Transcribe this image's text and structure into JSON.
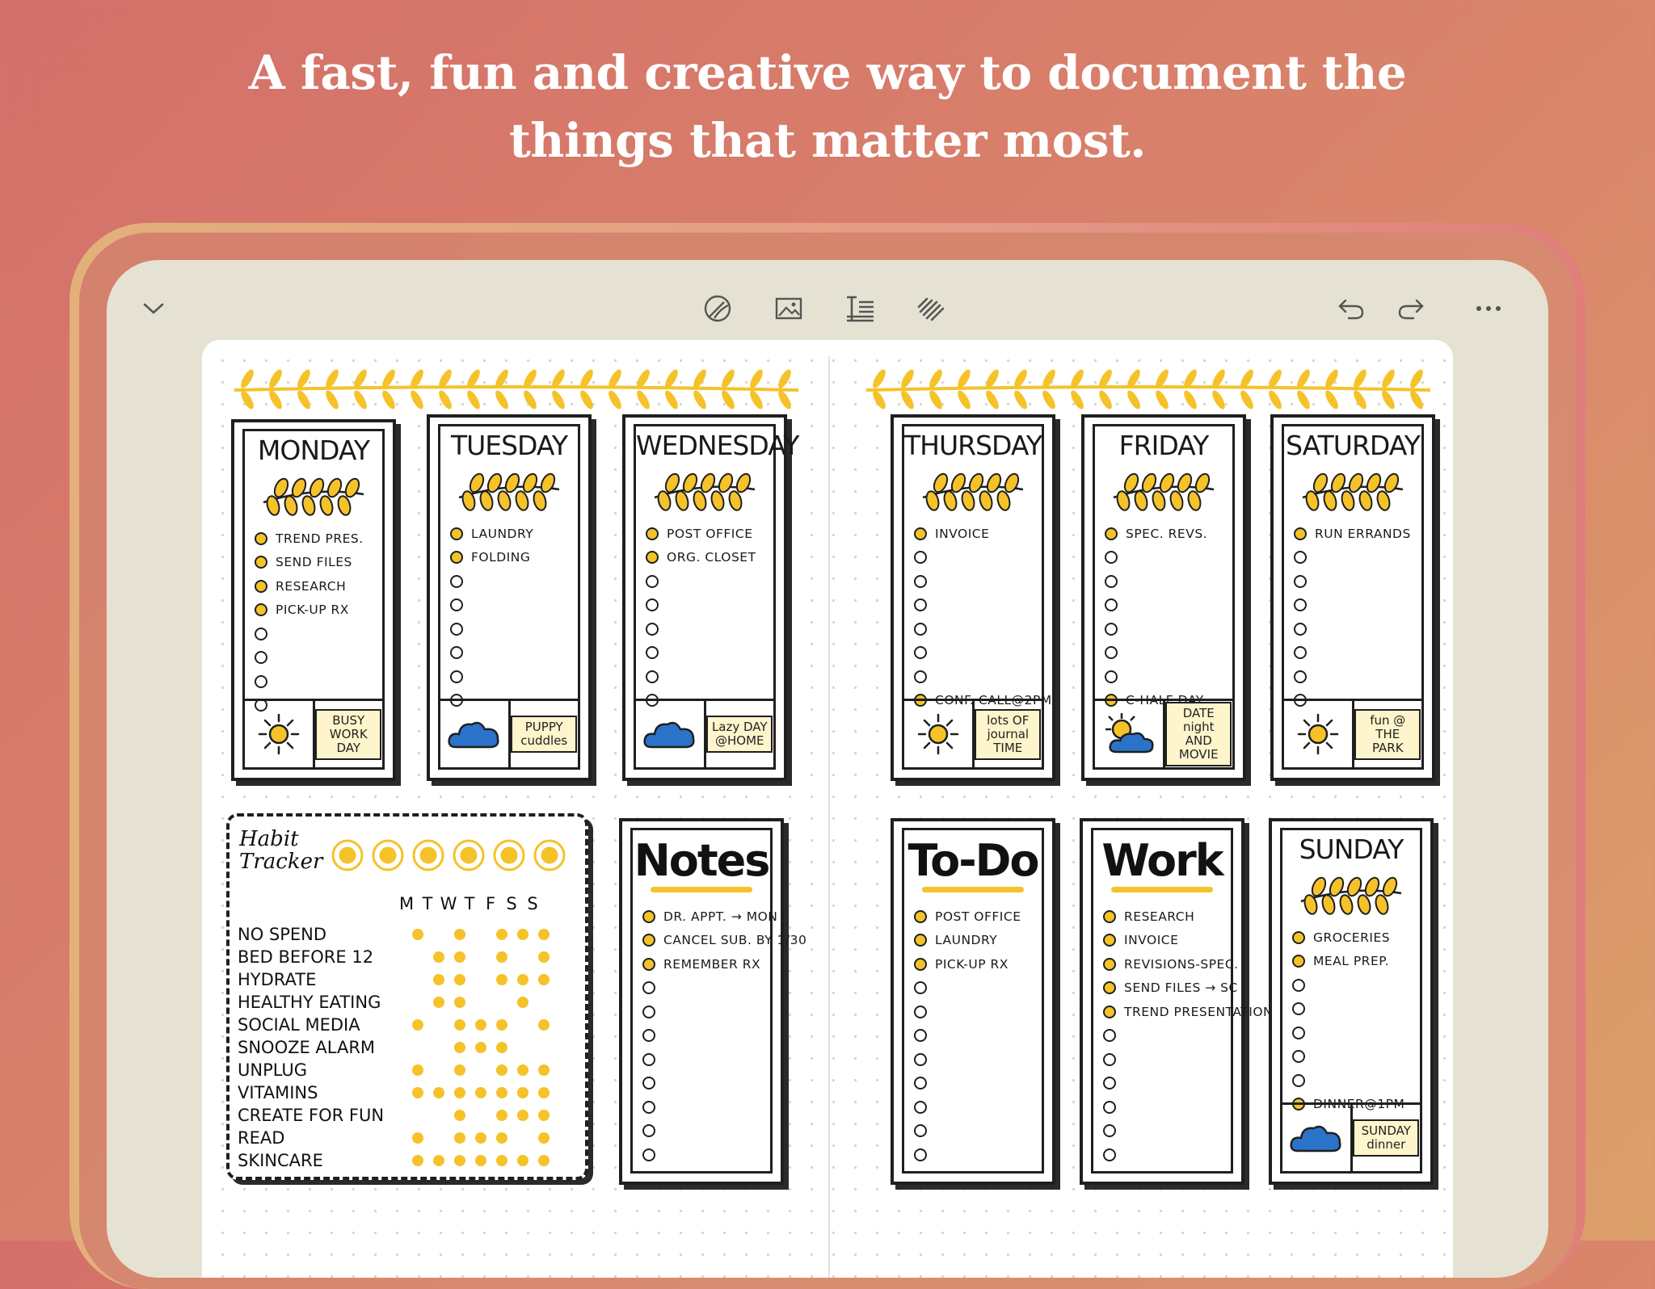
{
  "headline": {
    "line1": "A fast, fun and creative way to document the",
    "line2": "things that matter most."
  },
  "toolbar": {
    "collapse_icon": "chevron-down-icon",
    "tools": [
      "pen-eraser-icon",
      "image-icon",
      "text-icon",
      "scribble-icon"
    ],
    "undo_icon": "undo-icon",
    "redo_icon": "redo-icon",
    "more_icon": "more-icon"
  },
  "colors": {
    "accent": "#f5c22a",
    "ink": "#1f1f1f",
    "cloud": "#2a73c8"
  },
  "days": [
    {
      "title": "MONDAY",
      "tasks": [
        "TREND PRES.",
        "SEND FILES",
        "RESEARCH",
        "PICK-UP RX",
        "",
        "",
        "",
        ""
      ],
      "filled": 4,
      "doodle": "BUSY WORK DAY",
      "weather": "sun-icon"
    },
    {
      "title": "TUESDAY",
      "tasks": [
        "LAUNDRY",
        "FOLDING",
        "",
        "",
        "",
        "",
        "",
        ""
      ],
      "filled": 2,
      "doodle": "PUPPY cuddles",
      "weather": "cloud-icon"
    },
    {
      "title": "WEDNESDAY",
      "tasks": [
        "POST OFFICE",
        "ORG. CLOSET",
        "",
        "",
        "",
        "",
        "",
        ""
      ],
      "filled": 2,
      "doodle": "Lazy DAY @HOME",
      "weather": "cloud-icon"
    },
    {
      "title": "THURSDAY",
      "tasks": [
        "INVOICE",
        "",
        "",
        "",
        "",
        "",
        "",
        "CONF. CALL@2PM"
      ],
      "filled": [
        0,
        7
      ],
      "doodle": "lots OF journal TIME",
      "weather": "sun-icon"
    },
    {
      "title": "FRIDAY",
      "tasks": [
        "SPEC. REVS.",
        "",
        "",
        "",
        "",
        "",
        "",
        "C-HALF DAY"
      ],
      "filled": [
        0,
        7
      ],
      "doodle": "DATE night AND MOVIE",
      "weather": "sun-cloud-icon"
    },
    {
      "title": "SATURDAY",
      "tasks": [
        "RUN ERRANDS",
        "",
        "",
        "",
        "",
        "",
        "",
        ""
      ],
      "filled": [
        0
      ],
      "doodle": "fun @ THE PARK",
      "weather": "sun-icon"
    }
  ],
  "notes": {
    "title": "Notes",
    "tasks": [
      "DR. APPT. → MON",
      "CANCEL SUB. BY 1/30",
      "REMEMBER RX",
      "",
      "",
      "",
      "",
      "",
      "",
      "",
      ""
    ],
    "filled": 3
  },
  "todo": {
    "title": "To-Do",
    "tasks": [
      "POST OFFICE",
      "LAUNDRY",
      "PICK-UP RX",
      "",
      "",
      "",
      "",
      "",
      "",
      "",
      ""
    ],
    "filled": 3
  },
  "work": {
    "title": "Work",
    "tasks": [
      "RESEARCH",
      "INVOICE",
      "REVISIONS-SPEC.",
      "SEND FILES → SC",
      "TREND PRESENTATION",
      "",
      "",
      "",
      "",
      "",
      ""
    ],
    "filled": 5
  },
  "sunday": {
    "title": "SUNDAY",
    "tasks": [
      "GROCERIES",
      "MEAL PREP.",
      "",
      "",
      "",
      "",
      "",
      "DINNER@1PM"
    ],
    "filled": [
      0,
      1,
      7
    ],
    "doodle": "SUNDAY dinner",
    "weather": "cloud-icon"
  },
  "habit_tracker": {
    "title": "Habit Tracker",
    "days": [
      "M",
      "T",
      "W",
      "T",
      "F",
      "S",
      "S"
    ],
    "habits": [
      {
        "label": "NO SPEND",
        "marks": [
          1,
          0,
          1,
          0,
          1,
          1,
          1
        ]
      },
      {
        "label": "BED BEFORE 12",
        "marks": [
          0,
          1,
          1,
          0,
          1,
          0,
          1
        ]
      },
      {
        "label": "HYDRATE",
        "marks": [
          0,
          1,
          1,
          0,
          1,
          1,
          1
        ]
      },
      {
        "label": "HEALTHY EATING",
        "marks": [
          0,
          1,
          1,
          0,
          0,
          1,
          0
        ]
      },
      {
        "label": "SOCIAL MEDIA",
        "marks": [
          1,
          0,
          1,
          1,
          1,
          0,
          1
        ]
      },
      {
        "label": "SNOOZE ALARM",
        "marks": [
          0,
          0,
          1,
          1,
          1,
          0,
          0
        ]
      },
      {
        "label": "UNPLUG",
        "marks": [
          1,
          0,
          1,
          0,
          1,
          1,
          1
        ]
      },
      {
        "label": "VITAMINS",
        "marks": [
          1,
          1,
          1,
          1,
          1,
          1,
          1
        ]
      },
      {
        "label": "CREATE FOR FUN",
        "marks": [
          0,
          0,
          1,
          0,
          1,
          1,
          1
        ]
      },
      {
        "label": "READ",
        "marks": [
          1,
          0,
          1,
          1,
          1,
          0,
          1
        ]
      },
      {
        "label": "SKINCARE",
        "marks": [
          1,
          1,
          1,
          1,
          1,
          1,
          1
        ]
      }
    ]
  }
}
